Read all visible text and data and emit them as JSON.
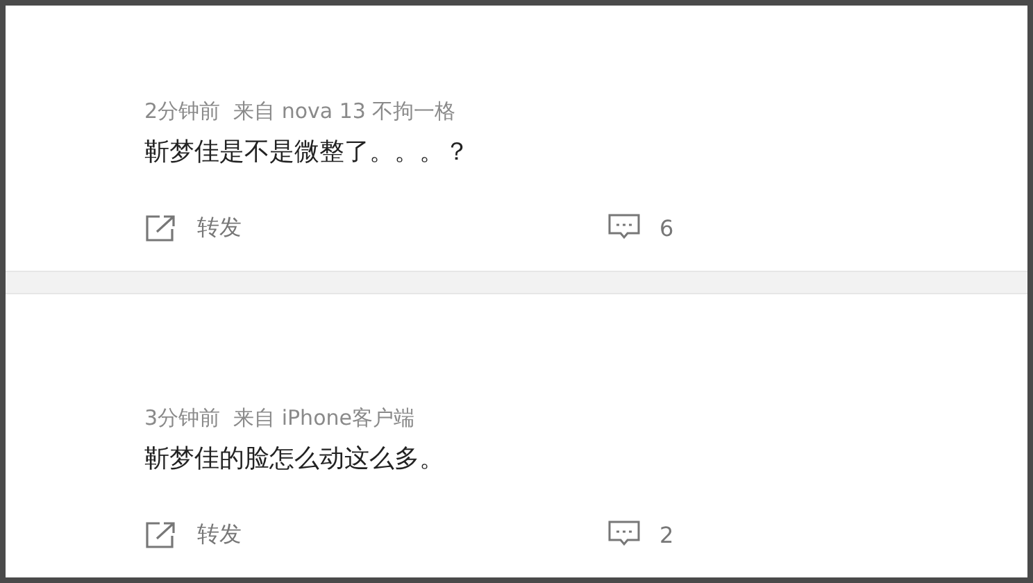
{
  "posts": [
    {
      "meta": "2分钟前  来自 nova 13 不拘一格",
      "text": "靳梦佳是不是微整了。。。？",
      "repost_label": "转发",
      "comment_count": "6"
    },
    {
      "meta": "3分钟前  来自 iPhone客户端",
      "text": "靳梦佳的脸怎么动这么多。",
      "repost_label": "转发",
      "comment_count": "2"
    }
  ]
}
